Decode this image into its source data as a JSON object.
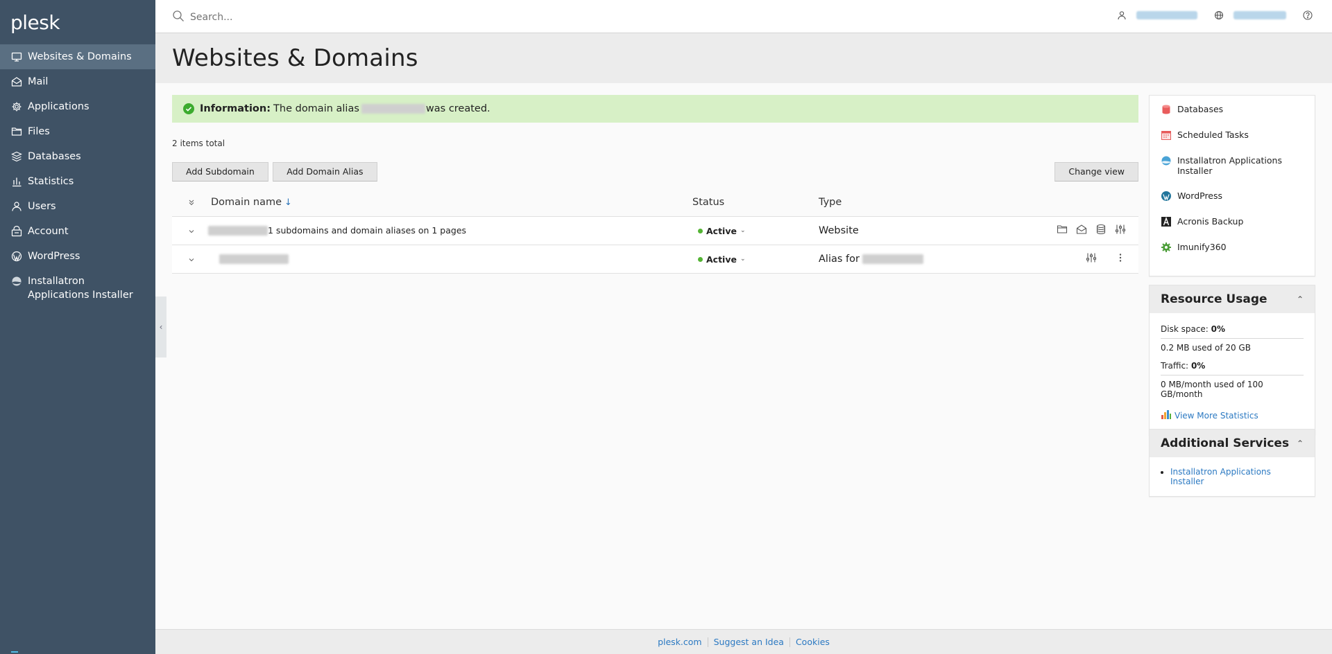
{
  "app": {
    "logo_text": "plesk"
  },
  "sidebar": {
    "items": [
      {
        "label": "Websites & Domains",
        "icon": "monitor-icon",
        "active": true
      },
      {
        "label": "Mail",
        "icon": "mail-icon"
      },
      {
        "label": "Applications",
        "icon": "gear-icon"
      },
      {
        "label": "Files",
        "icon": "folder-icon"
      },
      {
        "label": "Databases",
        "icon": "database-stack-icon"
      },
      {
        "label": "Statistics",
        "icon": "bar-chart-icon"
      },
      {
        "label": "Users",
        "icon": "user-icon"
      },
      {
        "label": "Account",
        "icon": "account-icon"
      },
      {
        "label": "WordPress",
        "icon": "wordpress-icon"
      },
      {
        "label": "Installatron Applications Installer",
        "icon": "installatron-icon"
      }
    ]
  },
  "header": {
    "search_placeholder": "Search...",
    "icons": [
      "user-icon",
      "globe-icon",
      "help-icon"
    ]
  },
  "page": {
    "title": "Websites & Domains"
  },
  "message": {
    "strong": "Information:",
    "before": "The domain alias",
    "after": "was created."
  },
  "list": {
    "items_total": "2 items total",
    "buttons": {
      "add_subdomain": "Add Subdomain",
      "add_alias": "Add Domain Alias",
      "change_view": "Change view"
    },
    "columns": {
      "domain": "Domain name",
      "sort_arrow": "↓",
      "status": "Status",
      "type": "Type"
    },
    "rows": [
      {
        "domain_suffix": "1 subdomains and domain aliases on 1 pages",
        "status": "Active",
        "type": "Website"
      },
      {
        "domain_suffix": "",
        "status": "Active",
        "type": "Alias for"
      }
    ]
  },
  "side_links": [
    {
      "label": "Databases",
      "icon": "databases-icon"
    },
    {
      "label": "Scheduled Tasks",
      "icon": "calendar-icon"
    },
    {
      "label": "Installatron Applications Installer",
      "icon": "installatron-icon"
    },
    {
      "label": "WordPress",
      "icon": "wordpress-icon"
    },
    {
      "label": "Acronis Backup",
      "icon": "acronis-icon"
    },
    {
      "label": "Imunify360",
      "icon": "imunify-gear-icon"
    }
  ],
  "resource_usage": {
    "title": "Resource Usage",
    "disk_label": "Disk space:",
    "disk_value": "0%",
    "disk_detail": "0.2 MB used of 20 GB",
    "traffic_label": "Traffic:",
    "traffic_value": "0%",
    "traffic_detail": "0 MB/month used of 100 GB/month",
    "more_link": "View More Statistics"
  },
  "additional_services": {
    "title": "Additional Services",
    "items": [
      "Installatron Applications Installer"
    ]
  },
  "footer": {
    "links": [
      "plesk.com",
      "Suggest an Idea",
      "Cookies"
    ]
  },
  "colors": {
    "sidebar_bg": "#3f5265",
    "sidebar_active": "#5a6f82",
    "success_bg": "#d7f0c6",
    "link": "#2b79c2",
    "status_active": "#54b434"
  }
}
